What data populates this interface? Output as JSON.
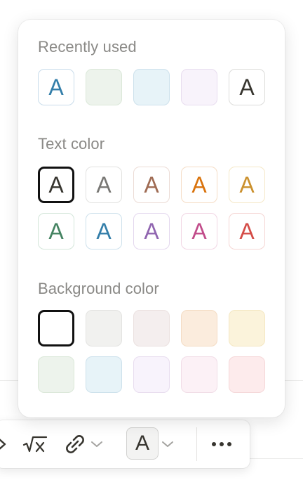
{
  "popup": {
    "recent": {
      "title": "Recently used",
      "items": [
        {
          "glyph": "A",
          "color": "#337ea9",
          "bg": "#ffffff",
          "border": "#c9dceb"
        },
        {
          "glyph": "",
          "color": "",
          "bg": "#edf3ec",
          "border": "#dbe8d9"
        },
        {
          "glyph": "",
          "color": "",
          "bg": "#e7f3f8",
          "border": "#cde1ec"
        },
        {
          "glyph": "",
          "color": "",
          "bg": "#f8f3fb",
          "border": "#e8ddef"
        },
        {
          "glyph": "A",
          "color": "#37352f",
          "bg": "#ffffff",
          "border": "#dcdcda"
        }
      ]
    },
    "text_color": {
      "title": "Text color",
      "items": [
        {
          "glyph": "A",
          "name": "default",
          "color": "#37352f",
          "border": "#111111",
          "selected": true
        },
        {
          "glyph": "A",
          "name": "gray",
          "color": "#787774",
          "border": "#e2e2e0"
        },
        {
          "glyph": "A",
          "name": "brown",
          "color": "#9f6b53",
          "border": "#ecdcd6"
        },
        {
          "glyph": "A",
          "name": "orange",
          "color": "#d9730d",
          "border": "#f5ddc6"
        },
        {
          "glyph": "A",
          "name": "yellow",
          "color": "#cb912f",
          "border": "#f5e8c8"
        },
        {
          "glyph": "A",
          "name": "green",
          "color": "#448361",
          "border": "#d4e6da"
        },
        {
          "glyph": "A",
          "name": "blue",
          "color": "#337ea9",
          "border": "#cde1ec"
        },
        {
          "glyph": "A",
          "name": "purple",
          "color": "#9065b0",
          "border": "#e4d8ee"
        },
        {
          "glyph": "A",
          "name": "pink",
          "color": "#c14c8a",
          "border": "#f1d6e4"
        },
        {
          "glyph": "A",
          "name": "red",
          "color": "#d44c47",
          "border": "#f5d6d4"
        }
      ]
    },
    "background_color": {
      "title": "Background color",
      "items": [
        {
          "name": "default",
          "bg": "#ffffff",
          "border": "#111111",
          "selected": true
        },
        {
          "name": "gray",
          "bg": "#f1f1ef",
          "border": "#e3e3e1"
        },
        {
          "name": "brown",
          "bg": "#f4eeee",
          "border": "#ebe1e0"
        },
        {
          "name": "orange",
          "bg": "#fbecdd",
          "border": "#f4dcc4"
        },
        {
          "name": "yellow",
          "bg": "#fbf3db",
          "border": "#f4e7c3"
        },
        {
          "name": "green",
          "bg": "#edf3ec",
          "border": "#dbe8d9"
        },
        {
          "name": "blue",
          "bg": "#e7f3f8",
          "border": "#cde1ec"
        },
        {
          "name": "purple",
          "bg": "#f8f3fc",
          "border": "#e8ddef"
        },
        {
          "name": "pink",
          "bg": "#fcf1f6",
          "border": "#f1dde7"
        },
        {
          "name": "red",
          "bg": "#fdebec",
          "border": "#f5d8d9"
        }
      ]
    }
  },
  "toolbar": {
    "icons": [
      "chevron-right-icon",
      "math-sqrt-icon",
      "link-icon",
      "chevron-down-icon",
      "text-color-icon",
      "chevron-down-icon",
      "more-horizontal-icon"
    ],
    "text_color_label": "A"
  }
}
